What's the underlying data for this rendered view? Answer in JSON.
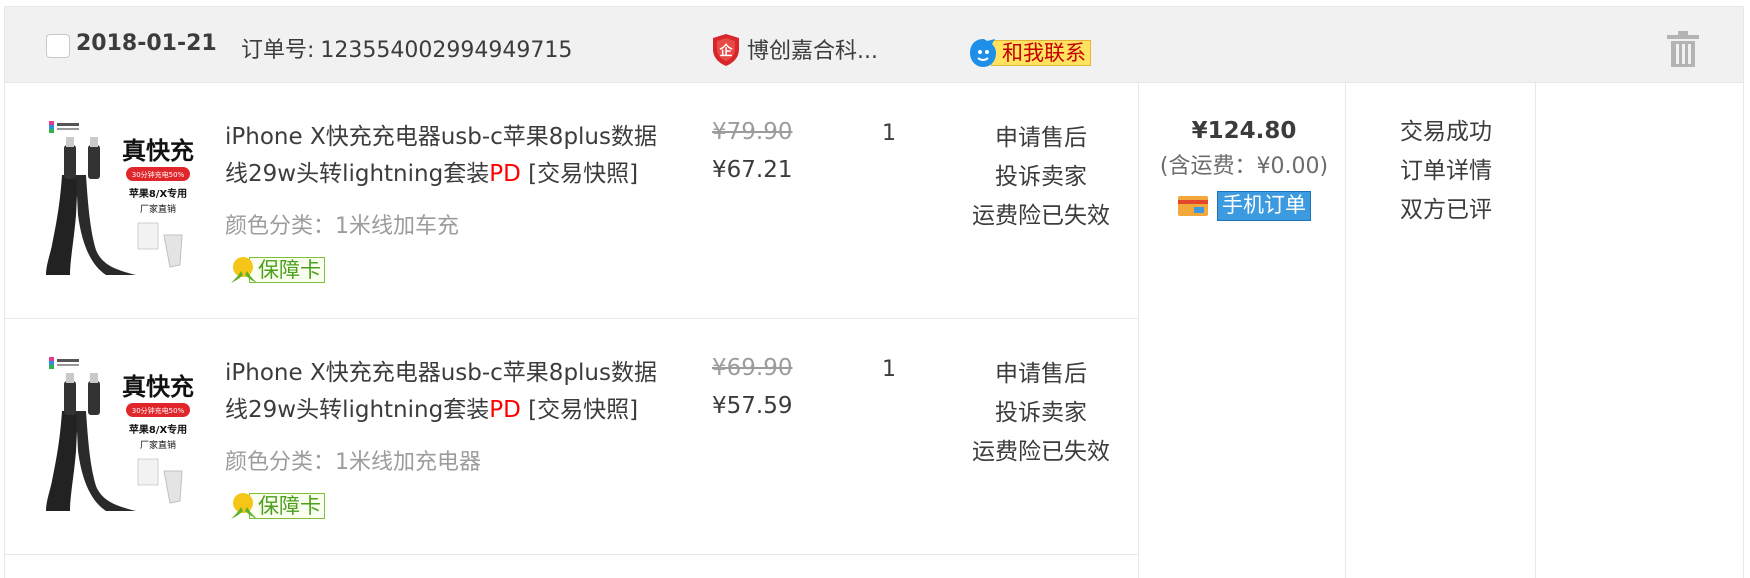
{
  "header": {
    "date": "2018-01-21",
    "order_no_label": "订单号:",
    "order_no": "123554002994949715",
    "shop_name": "博创嘉合科...",
    "contact_label": "和我联系"
  },
  "items": [
    {
      "title": "iPhone X快充充电器usb-c苹果8plus数据线29w头转lightning套装",
      "title_highlight": "PD",
      "snapshot": "[交易快照]",
      "sku": "颜色分类：1米线加车充",
      "guarantee": "保障卡",
      "price_original": "¥79.90",
      "price_now": "¥67.21",
      "quantity": "1",
      "ops": [
        "申请售后",
        "投诉卖家",
        "运费险已失效"
      ]
    },
    {
      "title": "iPhone X快充充电器usb-c苹果8plus数据线29w头转lightning套装",
      "title_highlight": "PD",
      "snapshot": "[交易快照]",
      "sku": "颜色分类：1米线加充电器",
      "guarantee": "保障卡",
      "price_original": "¥69.90",
      "price_now": "¥57.59",
      "quantity": "1",
      "ops": [
        "申请售后",
        "投诉卖家",
        "运费险已失效"
      ]
    }
  ],
  "total": {
    "amount": "¥124.80",
    "shipping": "(含运费：¥0.00)",
    "mobile_label": "手机订单"
  },
  "status": {
    "state": "交易成功",
    "detail_link": "订单详情",
    "review": "双方已评"
  },
  "product_image_text": {
    "headline": "真快充",
    "badge": "30分钟充电50%",
    "line1": "苹果8/X专用",
    "line2": "厂家直销"
  },
  "colors": {
    "header_bg": "#f1f1f1",
    "border": "#e8e8e8",
    "highlight_red": "#ff0000",
    "muted": "#9c9c9c",
    "mobile_blue": "#3c9be0",
    "contact_yellow": "#ffe35f",
    "guarantee_green": "#4aa01c"
  },
  "icons": {
    "shop": "shield-enterprise-icon",
    "contact": "chat-bubble-icon",
    "delete": "trash-icon",
    "guarantee": "leaf-badge-icon",
    "mobile": "card-icon"
  }
}
